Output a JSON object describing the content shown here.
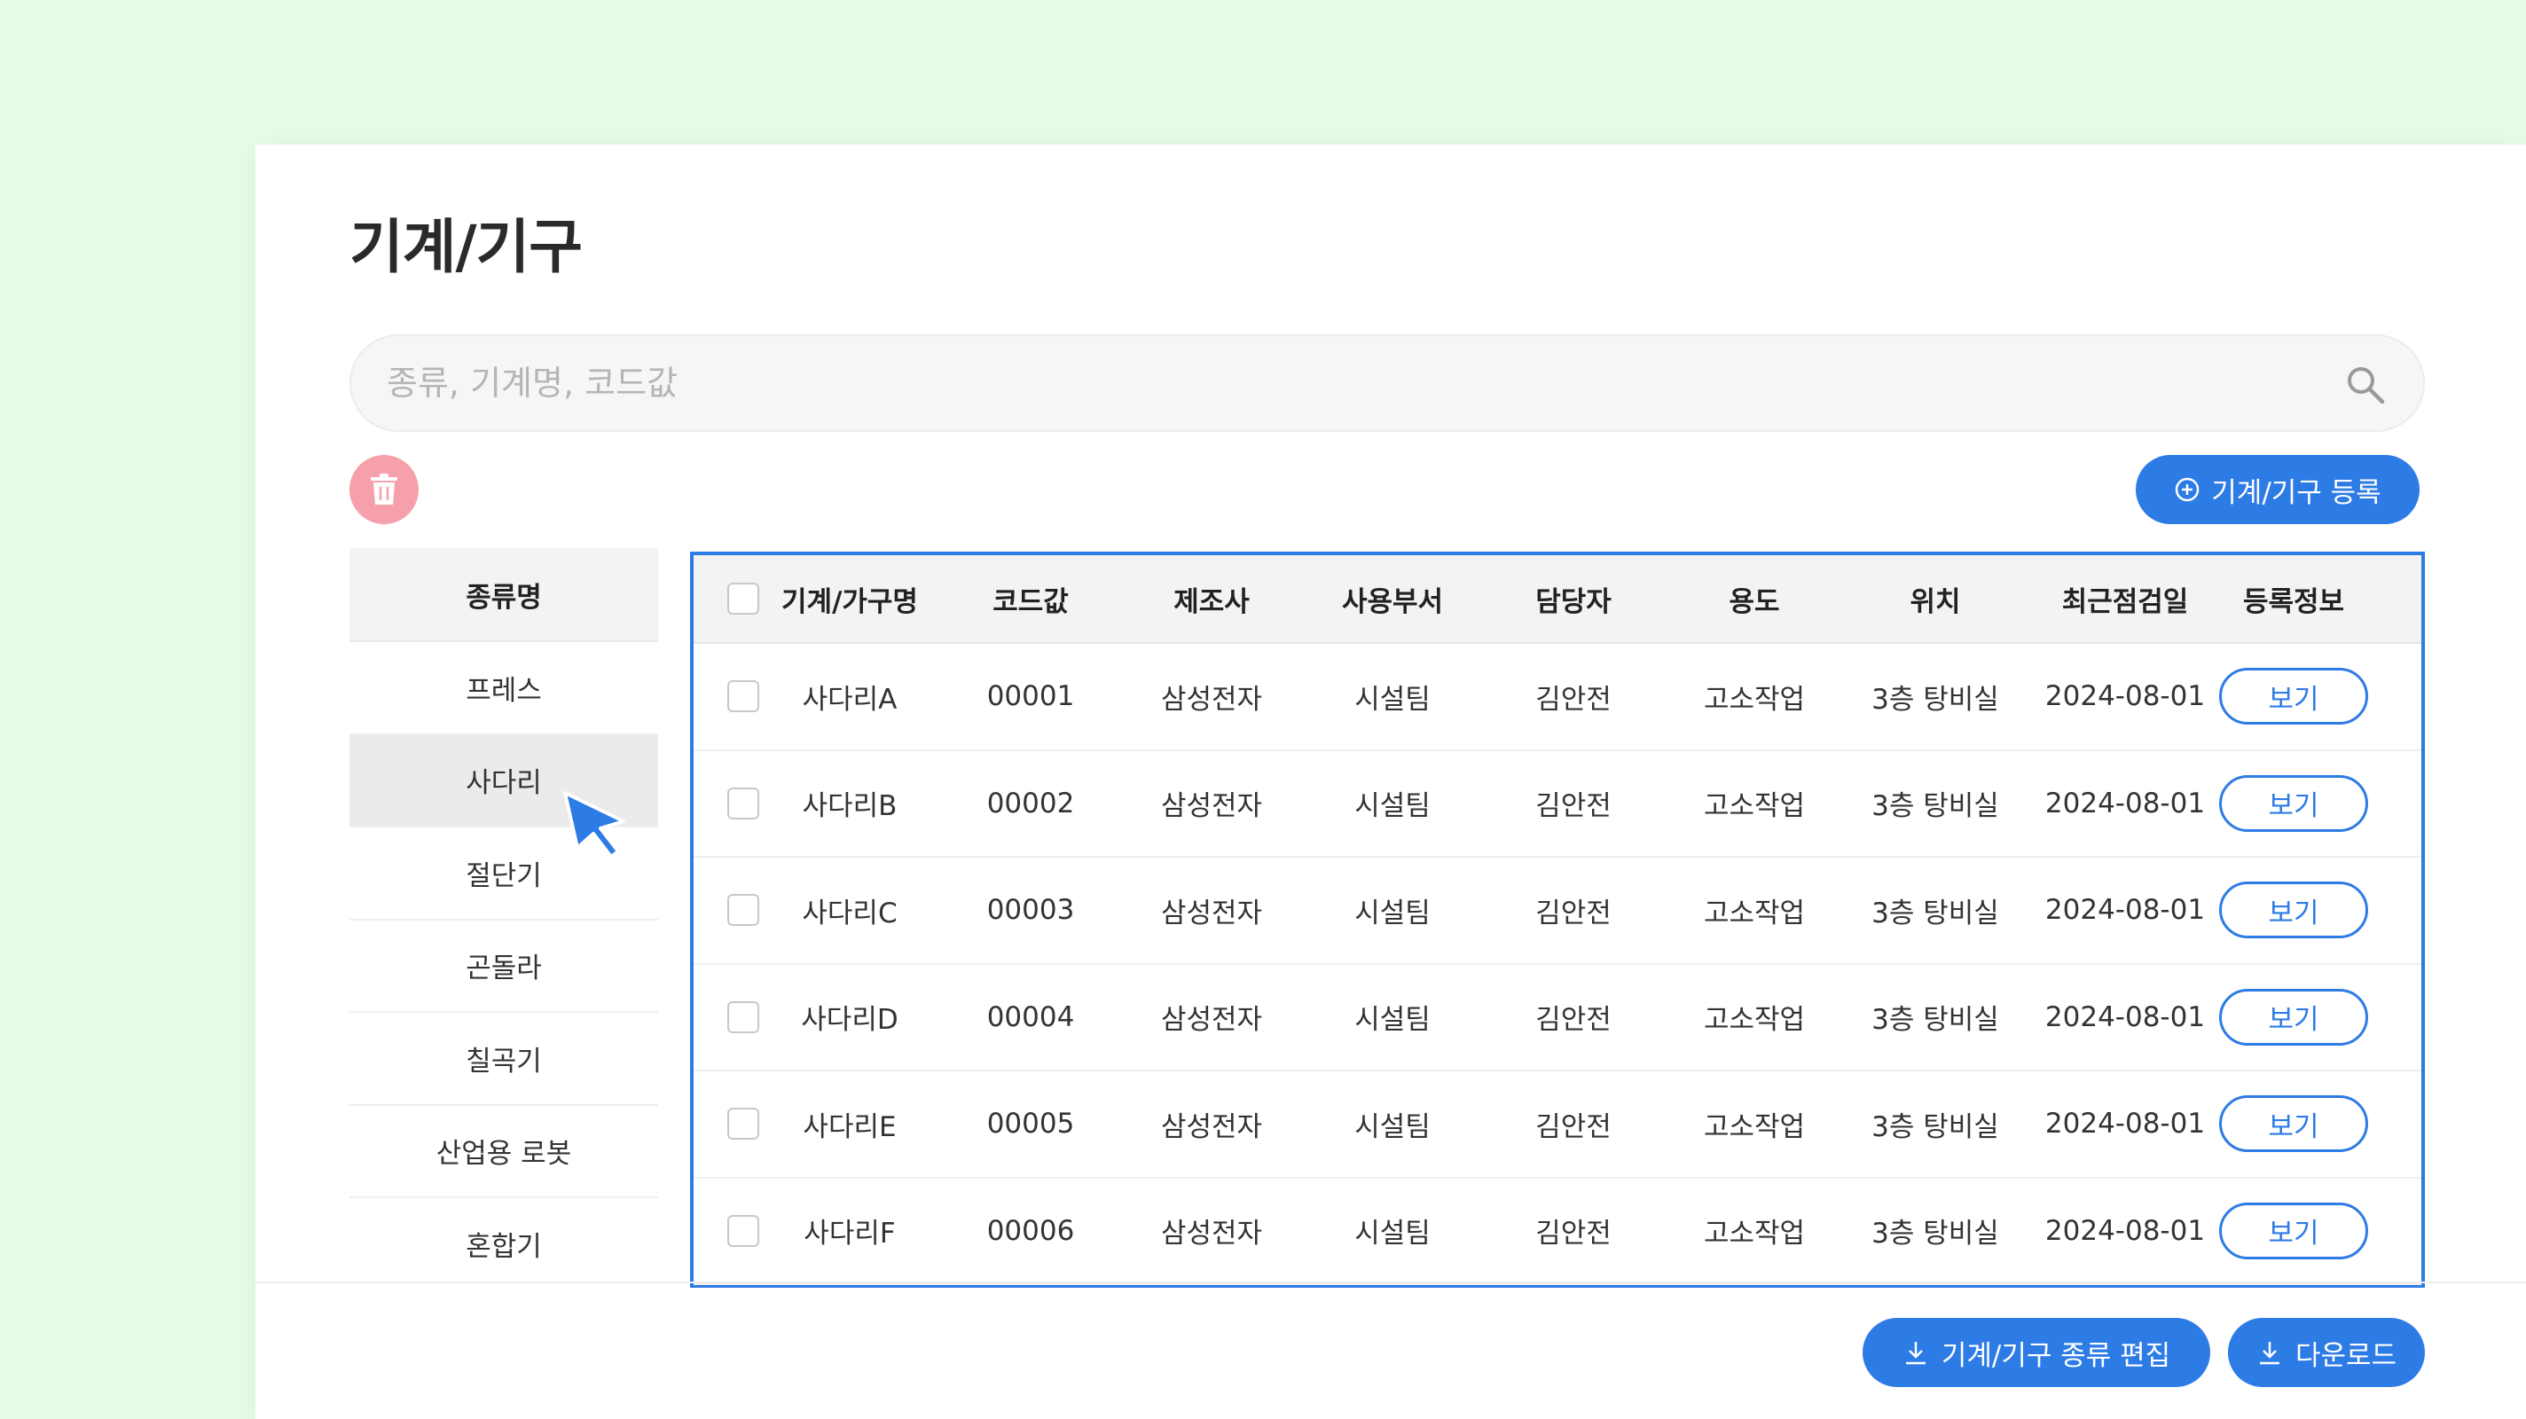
{
  "page": {
    "title": "기계/기구"
  },
  "search": {
    "placeholder": "종류, 기계명, 코드값"
  },
  "toolbar": {
    "register_label": "기계/기구 등록"
  },
  "categories": {
    "header": "종류명",
    "items": [
      "프레스",
      "사다리",
      "절단기",
      "곤돌라",
      "칠곡기",
      "산업용 로봇",
      "혼합기"
    ],
    "selected_index": 1
  },
  "table": {
    "headers": [
      "기계/가구명",
      "코드값",
      "제조사",
      "사용부서",
      "담당자",
      "용도",
      "위치",
      "최근점검일",
      "등록정보"
    ],
    "rows": [
      {
        "name": "사다리A",
        "code": "00001",
        "maker": "삼성전자",
        "dept": "시설팀",
        "manager": "김안전",
        "usage": "고소작업",
        "location": "3층 탕비실",
        "last_check": "2024-08-01",
        "action": "보기"
      },
      {
        "name": "사다리B",
        "code": "00002",
        "maker": "삼성전자",
        "dept": "시설팀",
        "manager": "김안전",
        "usage": "고소작업",
        "location": "3층 탕비실",
        "last_check": "2024-08-01",
        "action": "보기"
      },
      {
        "name": "사다리C",
        "code": "00003",
        "maker": "삼성전자",
        "dept": "시설팀",
        "manager": "김안전",
        "usage": "고소작업",
        "location": "3층 탕비실",
        "last_check": "2024-08-01",
        "action": "보기"
      },
      {
        "name": "사다리D",
        "code": "00004",
        "maker": "삼성전자",
        "dept": "시설팀",
        "manager": "김안전",
        "usage": "고소작업",
        "location": "3층 탕비실",
        "last_check": "2024-08-01",
        "action": "보기"
      },
      {
        "name": "사다리E",
        "code": "00005",
        "maker": "삼성전자",
        "dept": "시설팀",
        "manager": "김안전",
        "usage": "고소작업",
        "location": "3층 탕비실",
        "last_check": "2024-08-01",
        "action": "보기"
      },
      {
        "name": "사다리F",
        "code": "00006",
        "maker": "삼성전자",
        "dept": "시설팀",
        "manager": "김안전",
        "usage": "고소작업",
        "location": "3층 탕비실",
        "last_check": "2024-08-01",
        "action": "보기"
      }
    ]
  },
  "footer": {
    "edit_types_label": "기계/기구 종류 편집",
    "download_label": "다운로드"
  },
  "icons": {
    "search": "search-icon",
    "trash": "trash-icon",
    "add": "plus-circle-icon",
    "download": "download-icon",
    "cursor": "mouse-pointer-icon"
  },
  "colors": {
    "accent": "#2d7be5",
    "danger": "#f6a0ab",
    "background": "#e6fce6"
  }
}
